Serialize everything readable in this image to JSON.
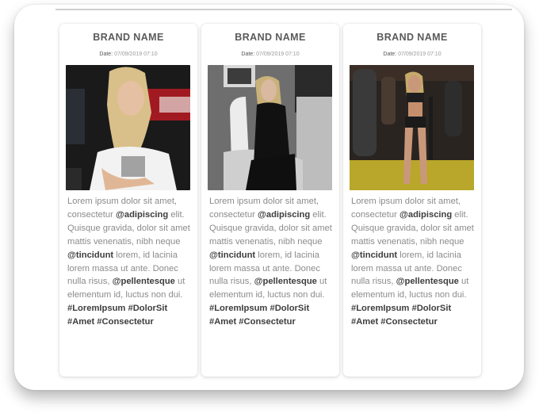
{
  "cards": [
    {
      "brand": "BRAND NAME",
      "date_label": "Date:",
      "date_value": "07/09/2019 07:10",
      "photo_icon": "photo-person-icon",
      "text": {
        "p1": "Lorem ipsum dolor sit amet, consectetur",
        "tag1": "@adipiscing",
        "p2": " elit. Quisque gravida, dolor sit amet mattis venenatis, nibh neque ",
        "tag2": "@tincidunt",
        "p3": " lorem, id lacinia lorem massa ut ante. Donec nulla risus, ",
        "tag3": "@pellentesque",
        "p4": " ut elementum id, luctus non dui. ",
        "hashtags": "#LoremIpsum #DolorSit #Amet #Consectetur"
      }
    },
    {
      "brand": "BRAND NAME",
      "date_label": "Date:",
      "date_value": "07/09/2019 07:10",
      "photo_icon": "photo-person-icon",
      "text": {
        "p1": "Lorem ipsum dolor sit amet, consectetur",
        "tag1": "@adipiscing",
        "p2": " elit. Quisque gravida, dolor sit amet mattis venenatis, nibh neque ",
        "tag2": "@tincidunt",
        "p3": " lorem, id lacinia lorem massa ut ante. Donec nulla risus, ",
        "tag3": "@pellentesque",
        "p4": " ut elementum id, luctus non dui. ",
        "hashtags": "#LoremIpsum #DolorSit #Amet #Consectetur"
      }
    },
    {
      "brand": "BRAND NAME",
      "date_label": "Date:",
      "date_value": "07/09/2019 07:10",
      "photo_icon": "photo-person-icon",
      "text": {
        "p1": "Lorem ipsum dolor sit amet, consectetur",
        "tag1": "@adipiscing",
        "p2": " elit. Quisque gravida, dolor sit amet mattis venenatis, nibh neque ",
        "tag2": "@tincidunt",
        "p3": " lorem, id lacinia lorem massa ut ante. Donec nulla risus, ",
        "tag3": "@pellentesque",
        "p4": " ut elementum id, luctus non dui. ",
        "hashtags": "#LoremIpsum #DolorSit #Amet #Consectetur"
      }
    }
  ]
}
